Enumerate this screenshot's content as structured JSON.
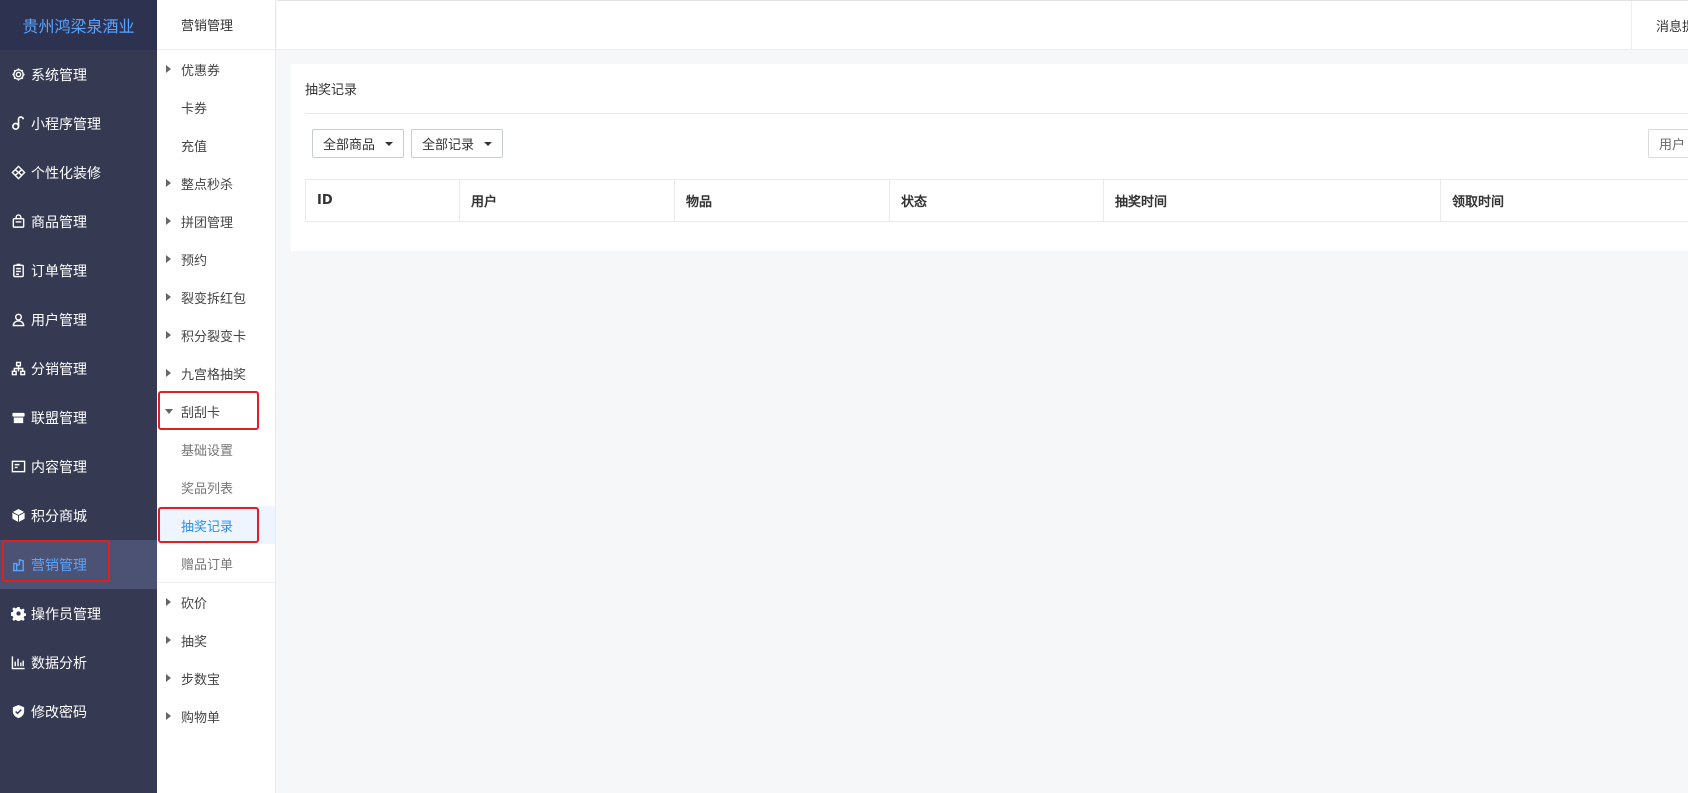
{
  "brand": "贵州鸿梁泉酒业",
  "sidebar": {
    "items": [
      {
        "label": "系统管理",
        "icon": "gear-outline-icon"
      },
      {
        "label": "小程序管理",
        "icon": "link-icon"
      },
      {
        "label": "个性化装修",
        "icon": "diamond-icon"
      },
      {
        "label": "商品管理",
        "icon": "bag-icon"
      },
      {
        "label": "订单管理",
        "icon": "clipboard-icon"
      },
      {
        "label": "用户管理",
        "icon": "user-icon"
      },
      {
        "label": "分销管理",
        "icon": "hierarchy-icon"
      },
      {
        "label": "联盟管理",
        "icon": "store-icon"
      },
      {
        "label": "内容管理",
        "icon": "layout-icon"
      },
      {
        "label": "积分商城",
        "icon": "cube-icon"
      },
      {
        "label": "营销管理",
        "icon": "marketing-icon",
        "active": true
      },
      {
        "label": "操作员管理",
        "icon": "gear-icon"
      },
      {
        "label": "数据分析",
        "icon": "bar-chart-icon"
      },
      {
        "label": "修改密码",
        "icon": "shield-icon"
      }
    ]
  },
  "submenu": {
    "title": "营销管理",
    "items_before": [
      "优惠券",
      "卡券",
      "充值",
      "整点秒杀",
      "拼团管理",
      "预约",
      "裂变拆红包",
      "积分裂变卡",
      "九宫格抽奖"
    ],
    "expandable_before": [
      true,
      false,
      false,
      true,
      true,
      true,
      true,
      true,
      true
    ],
    "expanded": "刮刮卡",
    "children": [
      "基础设置",
      "奖品列表",
      "抽奖记录",
      "赠品订单"
    ],
    "active_child": "抽奖记录",
    "items_after": [
      "砍价",
      "抽奖",
      "步数宝",
      "购物单"
    ]
  },
  "topbar": {
    "message": "消息提醒"
  },
  "main": {
    "title": "抽奖记录",
    "filter_product": "全部商品",
    "filter_record": "全部记录",
    "search_placeholder": "用户",
    "columns": [
      "ID",
      "用户",
      "物品",
      "状态",
      "抽奖时间",
      "领取时间"
    ]
  },
  "colors": {
    "sidebar_bg": "#353a52",
    "accent": "#2d8cf0",
    "highlight_box": "#e02020"
  }
}
